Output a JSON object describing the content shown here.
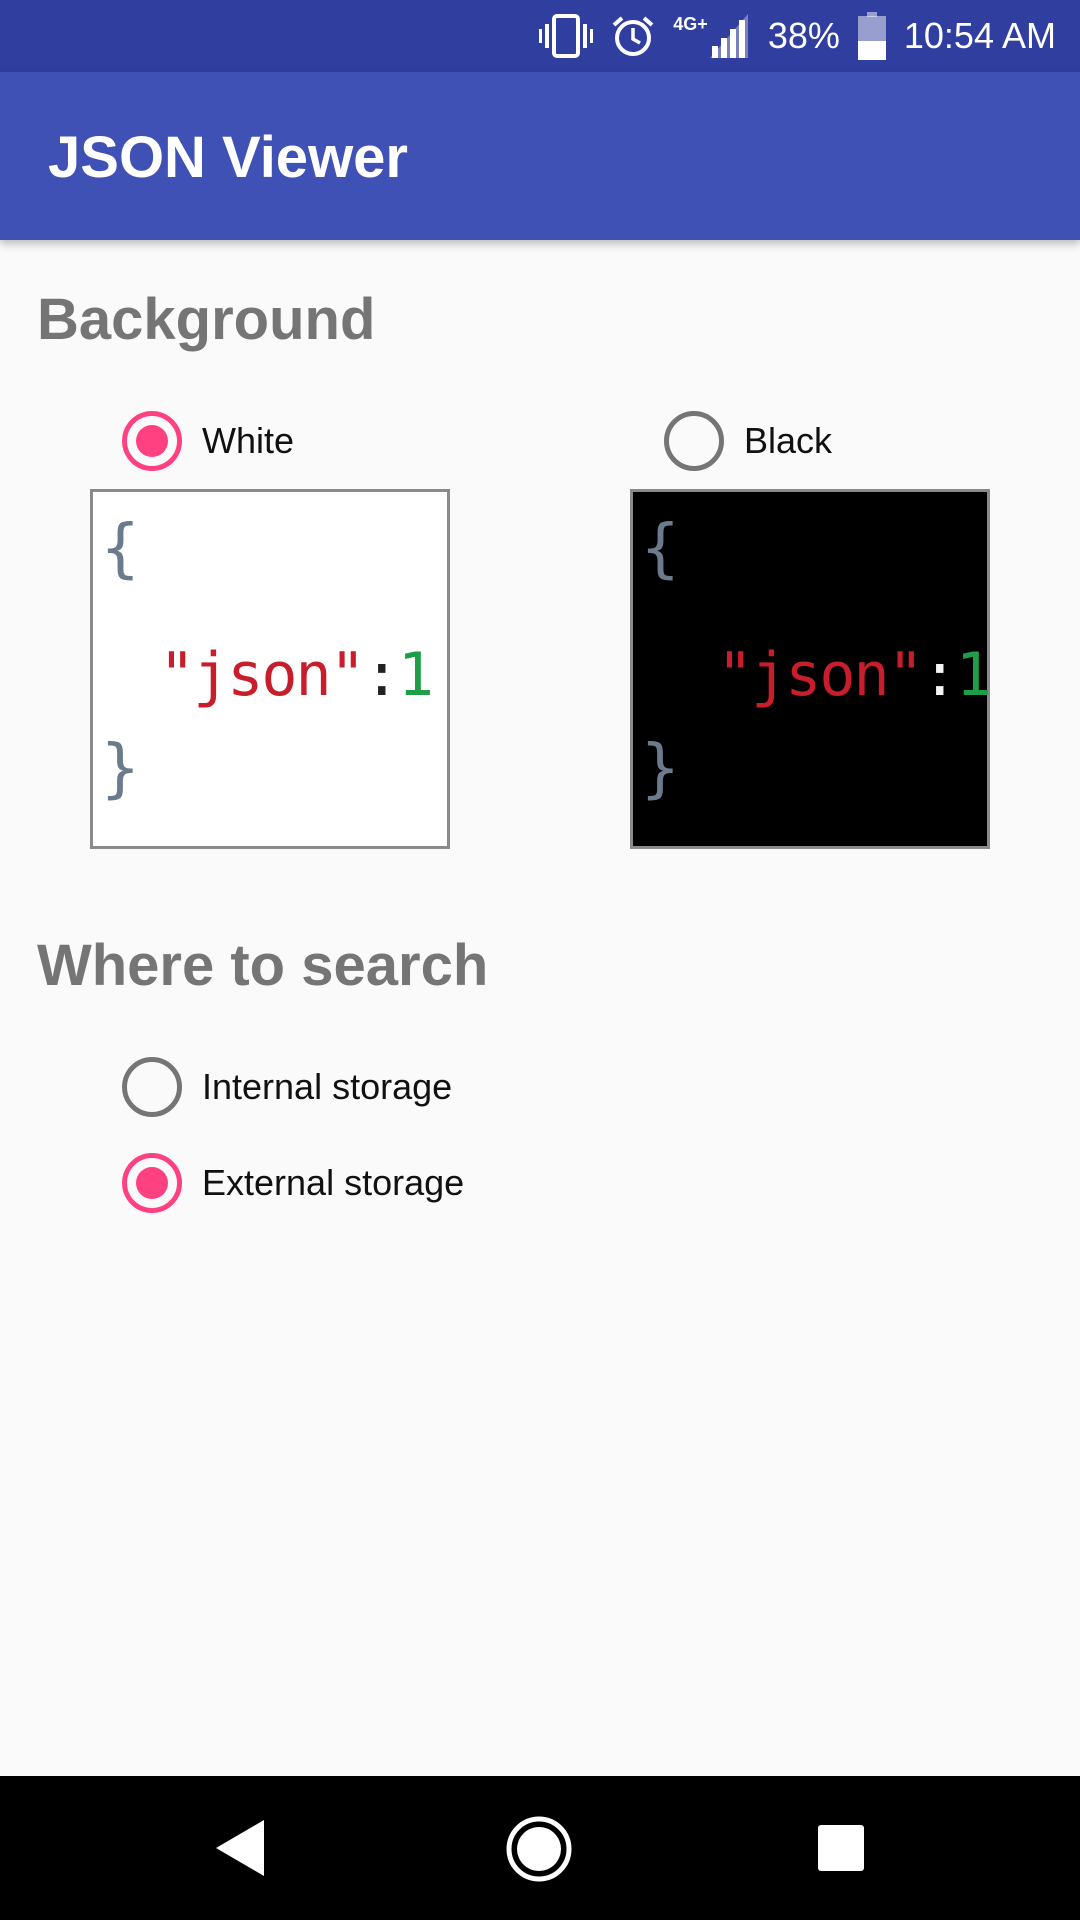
{
  "status_bar": {
    "network": "4G+",
    "battery": "38%",
    "time": "10:54 AM",
    "icons": [
      "vibrate-icon",
      "alarm-icon",
      "signal-icon",
      "battery-icon"
    ]
  },
  "app_bar": {
    "title": "JSON Viewer"
  },
  "background_section": {
    "title": "Background",
    "options": [
      {
        "label": "White",
        "checked": true
      },
      {
        "label": "Black",
        "checked": false
      }
    ],
    "preview": {
      "open_brace": "{",
      "key": "\"json\"",
      "colon": ":",
      "value": "1",
      "close_brace": "}"
    }
  },
  "search_section": {
    "title": "Where to search",
    "options": [
      {
        "label": "Internal storage",
        "checked": false
      },
      {
        "label": "External storage",
        "checked": true
      }
    ]
  },
  "navigation": {
    "buttons": [
      "back-icon",
      "home-icon",
      "recents-icon"
    ]
  },
  "colors": {
    "status_bar": "#303f9f",
    "app_bar": "#3f51b5",
    "accent": "#ff4081",
    "section_title": "#757575"
  }
}
